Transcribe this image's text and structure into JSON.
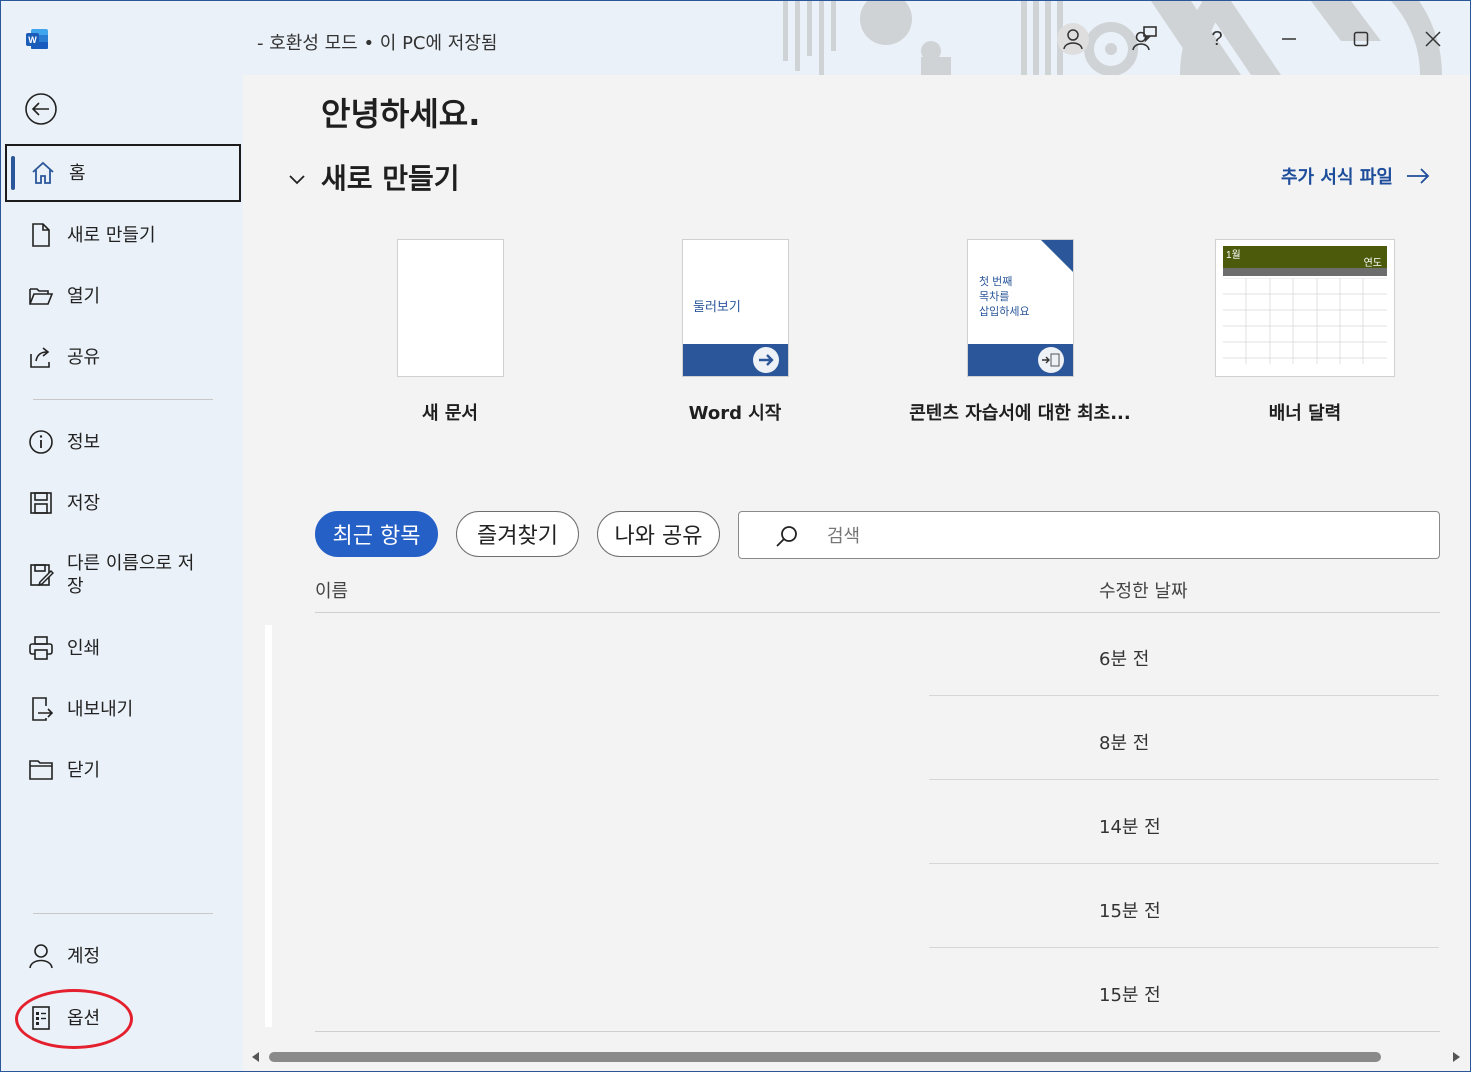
{
  "titlebar": {
    "title": "-  호환성 모드 • 이 PC에 저장됨",
    "help_label": "?"
  },
  "nav": {
    "items": [
      {
        "id": "home",
        "label": "홈"
      },
      {
        "id": "new",
        "label": "새로 만들기"
      },
      {
        "id": "open",
        "label": "열기"
      },
      {
        "id": "share",
        "label": "공유"
      },
      {
        "id": "info",
        "label": "정보"
      },
      {
        "id": "save",
        "label": "저장"
      },
      {
        "id": "saveas",
        "label": "다른 이름으로 저\n장"
      },
      {
        "id": "print",
        "label": "인쇄"
      },
      {
        "id": "export",
        "label": "내보내기"
      },
      {
        "id": "close",
        "label": "닫기"
      },
      {
        "id": "account",
        "label": "계정"
      },
      {
        "id": "options",
        "label": "옵션"
      }
    ]
  },
  "main": {
    "greeting": "안녕하세요.",
    "section_title": "새로 만들기",
    "more_templates": "추가 서식 파일",
    "templates": [
      {
        "name": "새 문서"
      },
      {
        "name": "Word 시작",
        "thumb_text": "둘러보기"
      },
      {
        "name": "콘텐츠 자습서에 대한 최초...",
        "thumb_text_1": "첫 번째",
        "thumb_text_2": "목차를",
        "thumb_text_3": "삽입하세요"
      },
      {
        "name": "배너 달력",
        "thumb_month": "1월",
        "thumb_year": "연도"
      }
    ],
    "filters": [
      "최근 항목",
      "즐겨찾기",
      "나와 공유"
    ],
    "search_placeholder": "검색",
    "columns": {
      "name": "이름",
      "modified": "수정한 날짜"
    },
    "rows": [
      {
        "modified": "6분 전"
      },
      {
        "modified": "8분 전"
      },
      {
        "modified": "14분 전"
      },
      {
        "modified": "15분 전"
      },
      {
        "modified": "15분 전"
      }
    ]
  },
  "colors": {
    "accent": "#2560c7",
    "brand": "#2b579a",
    "link": "#1e4e9b",
    "highlight": "#e5202e",
    "calendar_band": "#4b5a0b"
  }
}
